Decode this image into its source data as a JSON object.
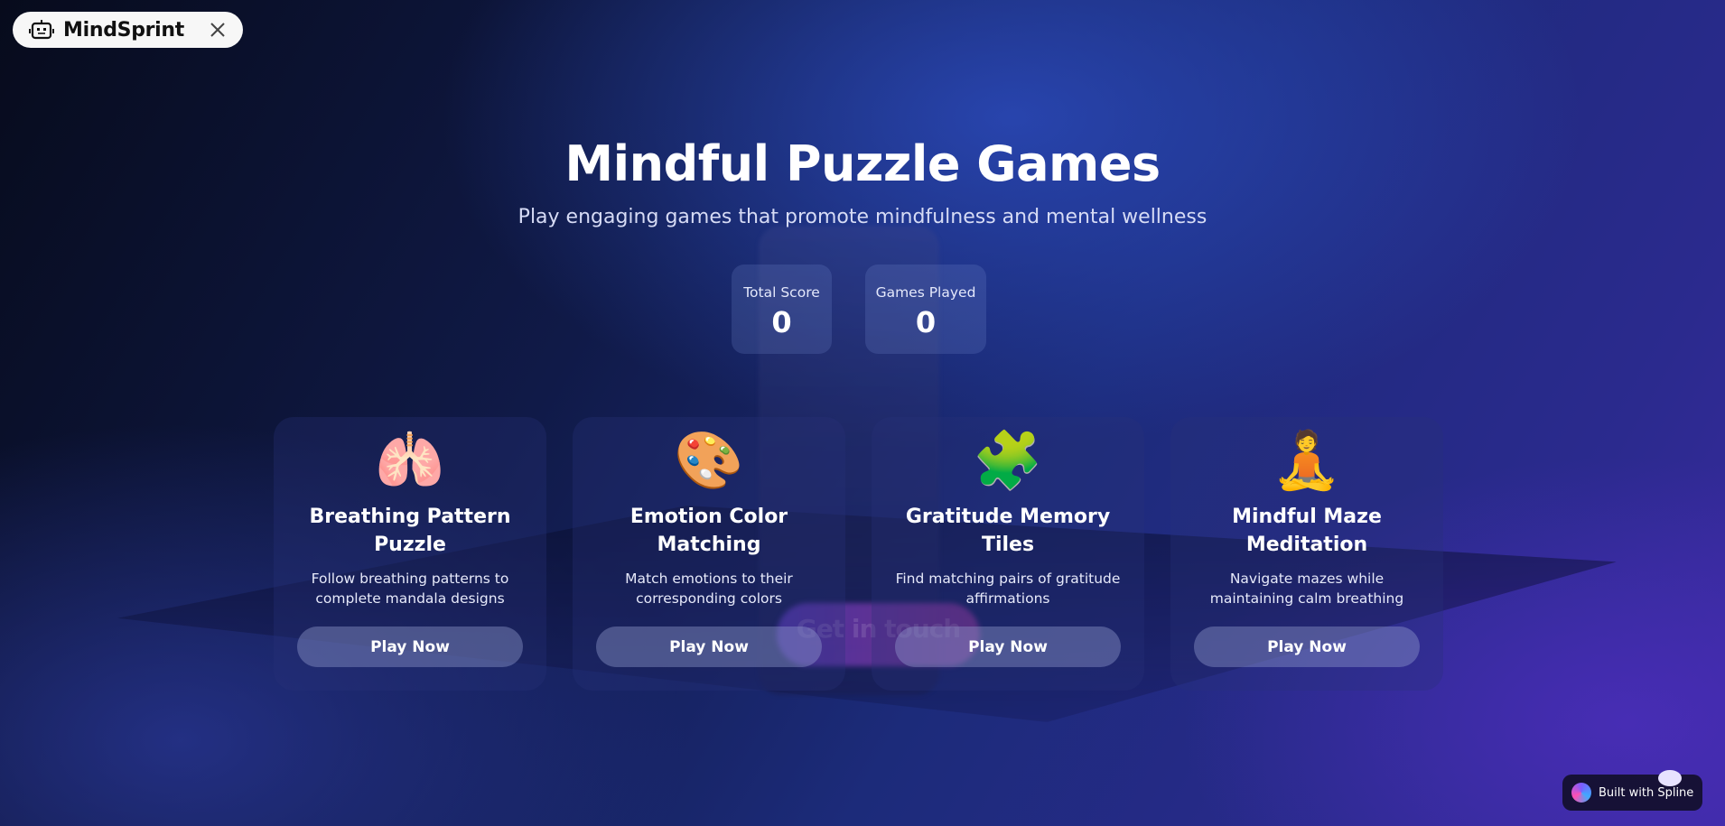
{
  "brand": {
    "name": "MindSprint",
    "icon": "robot-icon",
    "close_icon": "close-icon"
  },
  "hero": {
    "title": "Mindful Puzzle Games",
    "subtitle": "Play engaging games that promote mindfulness and mental wellness"
  },
  "stats": {
    "total_score_label": "Total Score",
    "total_score_value": "0",
    "games_played_label": "Games Played",
    "games_played_value": "0"
  },
  "games": [
    {
      "emoji": "🫁",
      "icon": "lungs-icon",
      "title": "Breathing Pattern Puzzle",
      "description": "Follow breathing patterns to complete mandala designs",
      "button": "Play Now"
    },
    {
      "emoji": "🎨",
      "icon": "palette-icon",
      "title": "Emotion Color Matching",
      "description": "Match emotions to their corresponding colors",
      "button": "Play Now"
    },
    {
      "emoji": "🧩",
      "icon": "puzzle-piece-icon",
      "title": "Gratitude Memory Tiles",
      "description": "Find matching pairs of gratitude affirmations",
      "button": "Play Now"
    },
    {
      "emoji": "🧘",
      "icon": "meditation-icon",
      "title": "Mindful Maze Meditation",
      "description": "Navigate mazes while maintaining calm breathing",
      "button": "Play Now"
    }
  ],
  "background": {
    "faded_text": "Get in touch"
  },
  "badge": {
    "text": "Built with Spline",
    "icon": "spline-logo-icon"
  },
  "colors": {
    "background_dark": "#070b1c",
    "background_blue": "#1c2b7a",
    "background_violet": "#3a2aa0",
    "pill_bg": "#f7f7f7"
  }
}
